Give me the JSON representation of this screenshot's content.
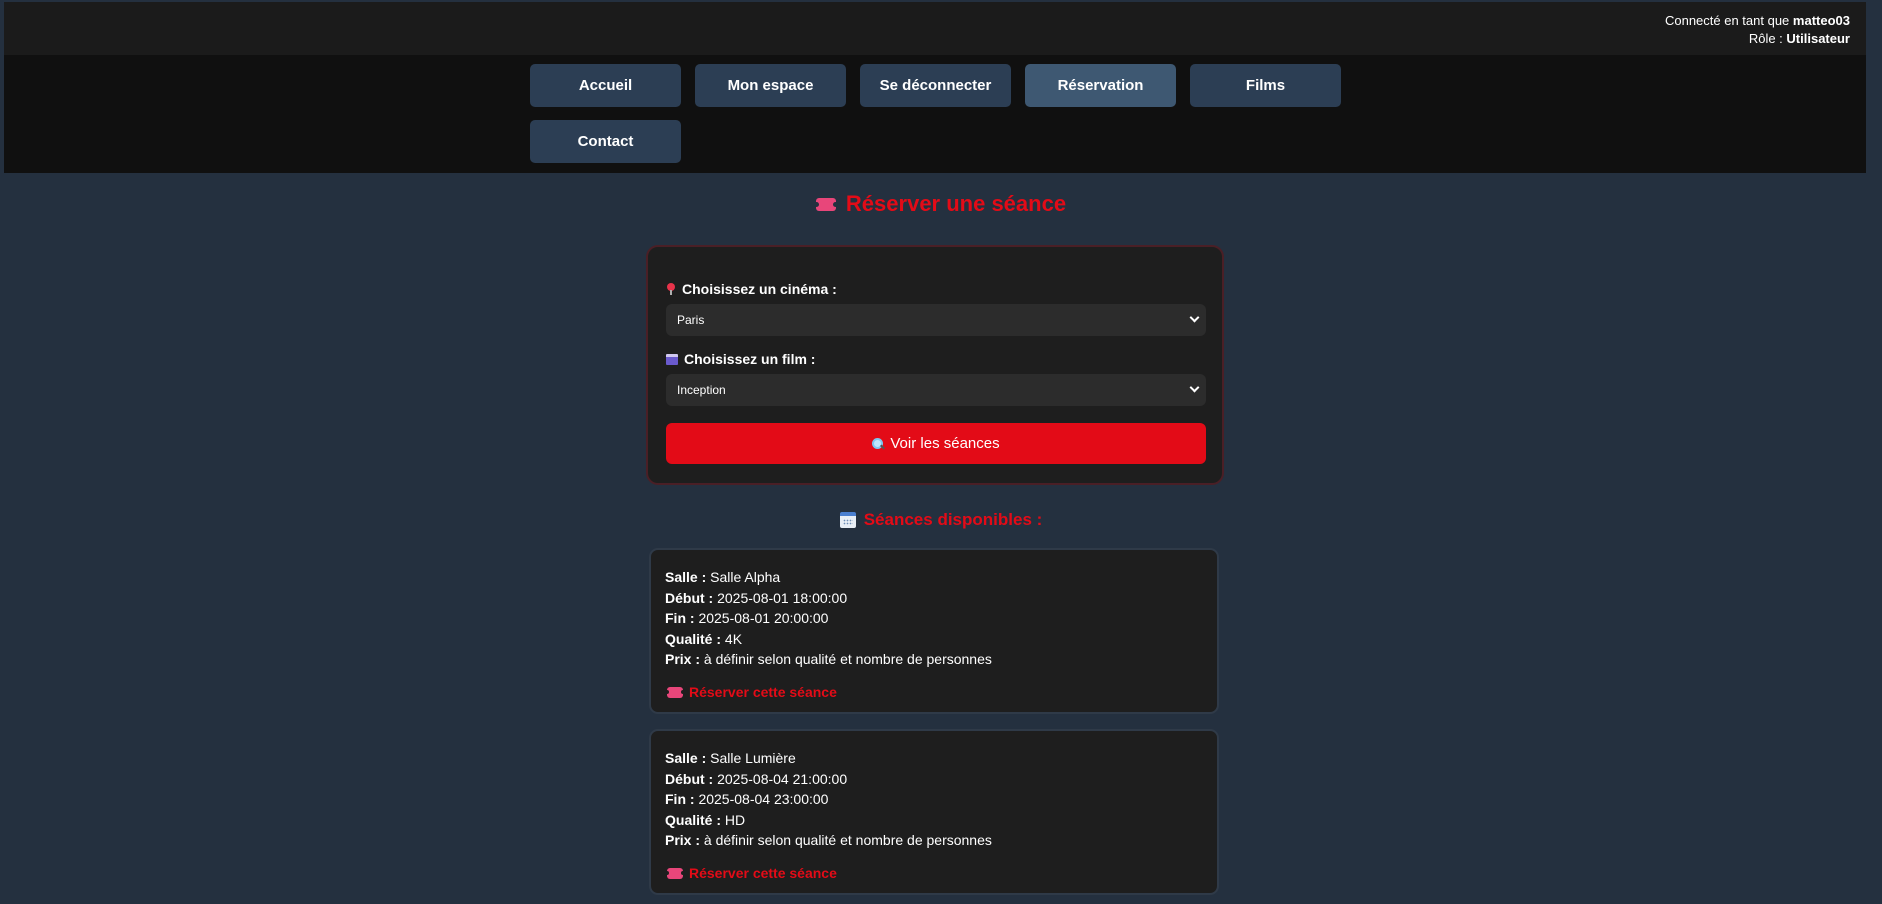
{
  "user": {
    "connected_prefix": "Connecté en tant que",
    "username": "matteo03",
    "role_prefix": "Rôle :",
    "role": "Utilisateur"
  },
  "nav": {
    "items": [
      {
        "label": "Accueil"
      },
      {
        "label": "Mon espace"
      },
      {
        "label": "Se déconnecter"
      },
      {
        "label": "Réservation"
      },
      {
        "label": "Films"
      },
      {
        "label": "Contact"
      }
    ]
  },
  "main": {
    "title": "Réserver une séance"
  },
  "form": {
    "cinema_label": "Choisissez un cinéma :",
    "cinema_value": "Paris",
    "film_label": "Choisissez un film :",
    "film_value": "Inception",
    "submit_label": "Voir les séances"
  },
  "sessions": {
    "title": "Séances disponibles :",
    "labels": {
      "salle": "Salle :",
      "debut": "Début :",
      "fin": "Fin :",
      "qualite": "Qualité :",
      "prix": "Prix :"
    },
    "reserve_label": "Réserver cette séance",
    "items": [
      {
        "salle": "Salle Alpha",
        "debut": "2025-08-01 18:00:00",
        "fin": "2025-08-01 20:00:00",
        "qualite": "4K",
        "prix": "à définir selon qualité et nombre de personnes"
      },
      {
        "salle": "Salle Lumière",
        "debut": "2025-08-04 21:00:00",
        "fin": "2025-08-04 23:00:00",
        "qualite": "HD",
        "prix": "à définir selon qualité et nombre de personnes"
      }
    ]
  },
  "icons": {
    "title": "ticket-icon",
    "cinema": "pin-icon",
    "film": "clapper-icon",
    "submit": "magnifier-icon",
    "sessions": "calendar-icon",
    "reserve": "ticket-icon"
  },
  "colors": {
    "accent": "#e30b17",
    "background": "#24303f",
    "nav_button": "#2c3e54",
    "nav_button_active": "#3e5872",
    "card": "#1e1e1e"
  }
}
